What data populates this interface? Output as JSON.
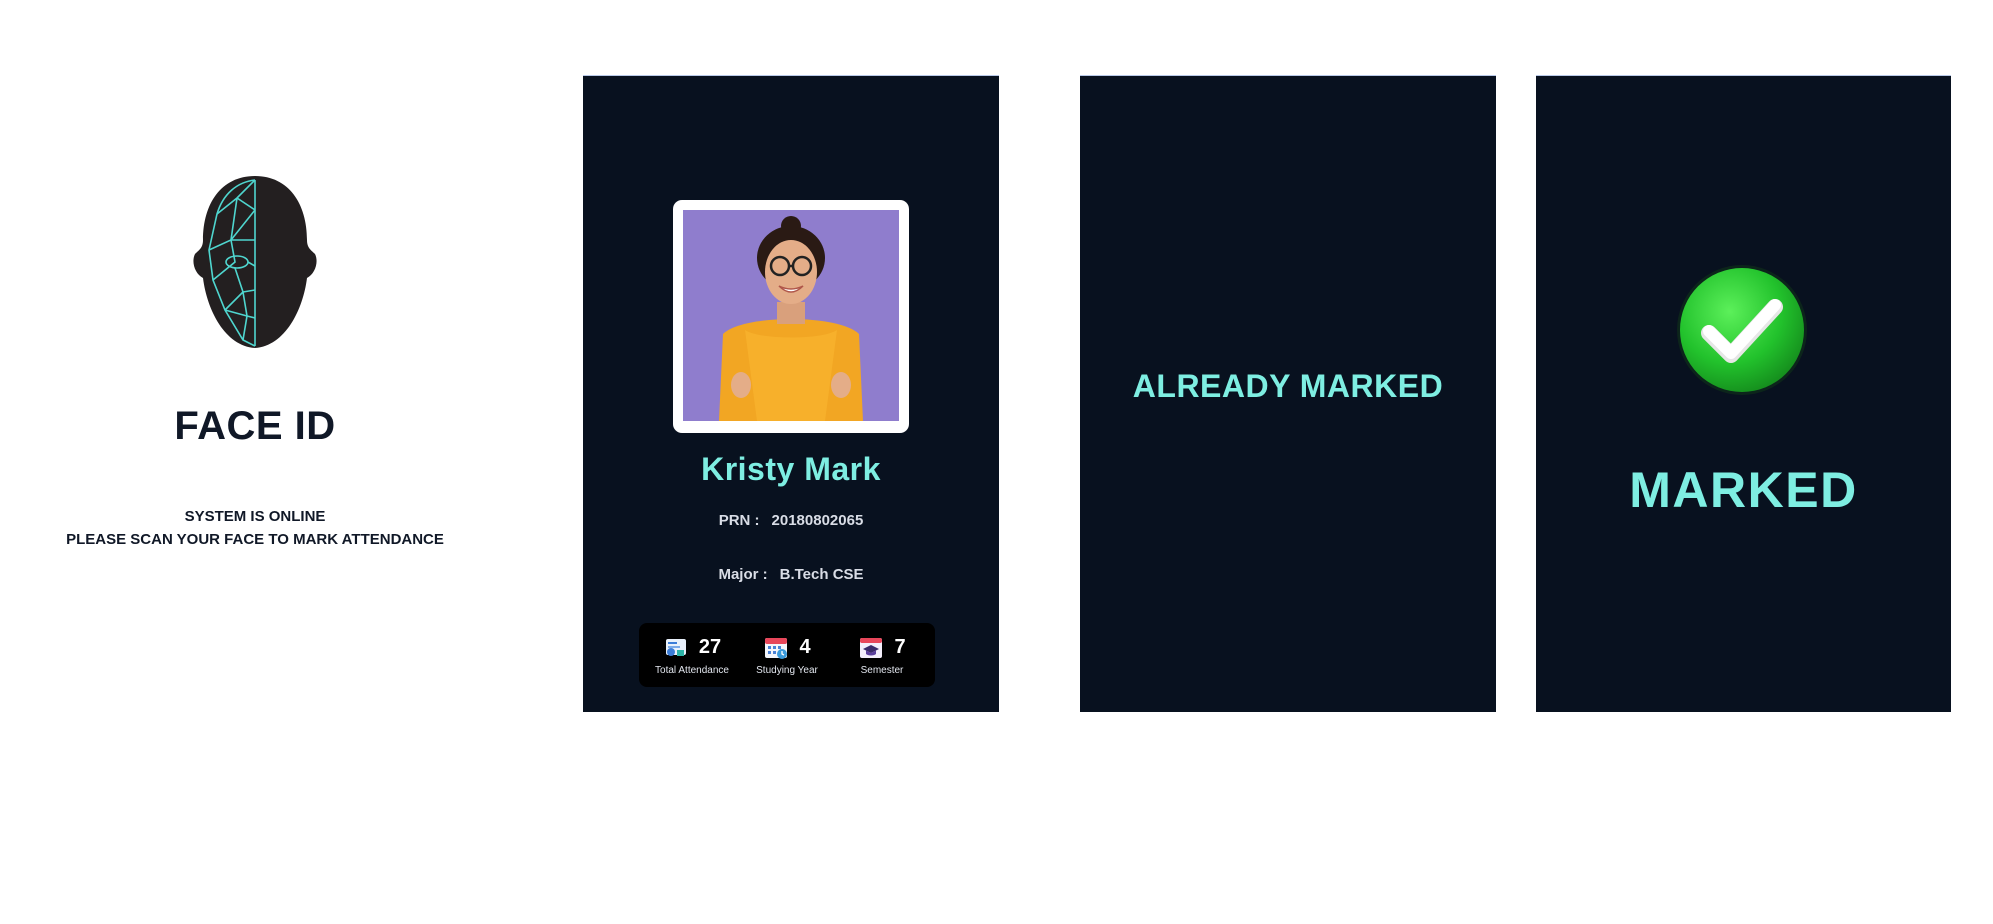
{
  "intro": {
    "title": "FACE ID",
    "status_line_1": "SYSTEM IS ONLINE",
    "status_line_2": "PLEASE SCAN YOUR FACE TO MARK ATTENDANCE",
    "icon": "face-scan-head-icon"
  },
  "profile": {
    "name": "Kristy Mark",
    "prn_label": "PRN :",
    "prn_value": "20180802065",
    "major_label": "Major :",
    "major_value": "B.Tech CSE",
    "stats": [
      {
        "icon": "attendance-icon",
        "value": "27",
        "label": "Total Attendance"
      },
      {
        "icon": "calendar-icon",
        "value": "4",
        "label": "Studying Year"
      },
      {
        "icon": "graduation-cap-icon",
        "value": "7",
        "label": "Semester"
      }
    ]
  },
  "already_marked": {
    "message": "ALREADY MARKED"
  },
  "marked": {
    "message": "MARKED",
    "icon": "green-check-icon"
  },
  "colors": {
    "panel_bg": "#08111f",
    "accent_text": "#7eeee2",
    "check_green": "#2ecc40"
  }
}
